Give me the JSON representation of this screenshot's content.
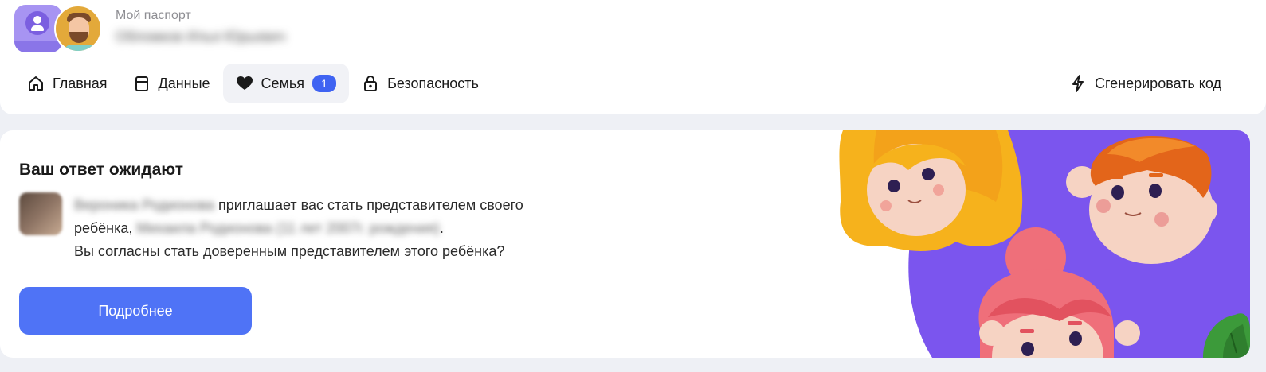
{
  "header": {
    "passport_label": "Мой паспорт",
    "user_name": "Обломков Илья Юрьевич"
  },
  "nav": {
    "items": [
      {
        "label": "Главная",
        "icon": "home-icon"
      },
      {
        "label": "Данные",
        "icon": "clipboard-icon"
      },
      {
        "label": "Семья",
        "icon": "heart-icon",
        "badge": "1",
        "active": true
      },
      {
        "label": "Безопасность",
        "icon": "lock-icon"
      }
    ],
    "generate_code": {
      "label": "Сгенерировать код",
      "icon": "lightning-icon"
    }
  },
  "invitation": {
    "title": "Ваш ответ ожидают",
    "inviter_name": "Вероника Родионова",
    "text_1": " приглашает вас стать представителем своего ребёнка, ",
    "child_info": "Михаила Родионова (11 лет 2007г. рождения)",
    "text_2": ".",
    "question": "Вы согласны стать доверенным представителем этого ребёнка?",
    "button_label": "Подробнее"
  },
  "colors": {
    "accent": "#4f73f6",
    "badge": "#3f63f2",
    "illustration_bg": "#7b55ee"
  }
}
